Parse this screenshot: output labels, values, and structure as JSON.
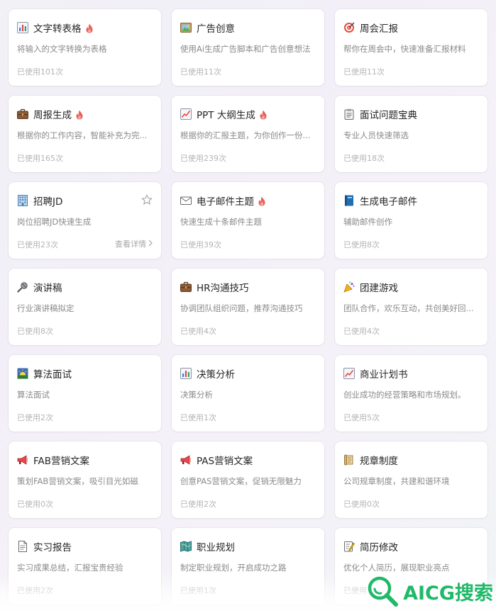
{
  "cards": [
    {
      "title": "文字转表格",
      "desc": "将输入的文字转换为表格",
      "usage": "已使用101次",
      "icon": "bar-chart-icon",
      "hot": true
    },
    {
      "title": "广告创意",
      "desc": "使用Ai生成广告脚本和广告创意想法",
      "usage": "已使用11次",
      "icon": "picture-icon",
      "hot": false
    },
    {
      "title": "周会汇报",
      "desc": "帮你在周会中，快速准备汇报材料",
      "usage": "已使用11次",
      "icon": "target-icon",
      "hot": false
    },
    {
      "title": "周报生成",
      "desc": "根据你的工作内容，智能补充为完...",
      "usage": "已使用165次",
      "icon": "briefcase-icon",
      "hot": true
    },
    {
      "title": "PPT 大纲生成",
      "desc": "根据你的汇报主题，为你创作一份...",
      "usage": "已使用239次",
      "icon": "trend-chart-icon",
      "hot": true
    },
    {
      "title": "面试问题宝典",
      "desc": "专业人员快速筛选",
      "usage": "已使用18次",
      "icon": "clipboard-icon",
      "hot": false
    },
    {
      "title": "招聘JD",
      "desc": "岗位招聘JD快速生成",
      "usage": "已使用23次",
      "icon": "office-building-icon",
      "hot": false
    },
    {
      "title": "电子邮件主题",
      "desc": "快速生成十条邮件主题",
      "usage": "已使用39次",
      "icon": "envelope-icon",
      "hot": true
    },
    {
      "title": "生成电子邮件",
      "desc": "辅助邮件创作",
      "usage": "已使用8次",
      "icon": "book-icon",
      "hot": false
    },
    {
      "title": "演讲稿",
      "desc": "行业演讲稿拟定",
      "usage": "已使用8次",
      "icon": "microphone-icon",
      "hot": false
    },
    {
      "title": "HR沟通技巧",
      "desc": "协调团队组织问题，推荐沟通技巧",
      "usage": "已使用4次",
      "icon": "briefcase-icon",
      "hot": false
    },
    {
      "title": "团建游戏",
      "desc": "团队合作，欢乐互动，共创美好回...",
      "usage": "已使用4次",
      "icon": "party-popper-icon",
      "hot": false
    },
    {
      "title": "算法面试",
      "desc": "算法面试",
      "usage": "已使用2次",
      "icon": "sunrise-icon",
      "hot": false
    },
    {
      "title": "决策分析",
      "desc": "决策分析",
      "usage": "已使用1次",
      "icon": "bar-chart-icon",
      "hot": false
    },
    {
      "title": "商业计划书",
      "desc": "创业成功的经营策略和市场规划。",
      "usage": "已使用5次",
      "icon": "trend-chart-icon",
      "hot": false
    },
    {
      "title": "FAB营销文案",
      "desc": "策划FAB营销文案，吸引目光如磁",
      "usage": "已使用0次",
      "icon": "megaphone-icon",
      "hot": false
    },
    {
      "title": "PAS营销文案",
      "desc": "创意PAS营销文案，促销无限魅力",
      "usage": "已使用2次",
      "icon": "megaphone-icon",
      "hot": false
    },
    {
      "title": "规章制度",
      "desc": "公司规章制度，共建和谐环境",
      "usage": "已使用0次",
      "icon": "scroll-icon",
      "hot": false
    },
    {
      "title": "实习报告",
      "desc": "实习成果总结，汇报宝贵经验",
      "usage": "已使用2次",
      "icon": "document-icon",
      "hot": false
    },
    {
      "title": "职业规划",
      "desc": "制定职业规划，开启成功之路",
      "usage": "已使用1次",
      "icon": "map-icon",
      "hot": false
    },
    {
      "title": "简历修改",
      "desc": "优化个人简历，展现职业亮点",
      "usage": "已使用",
      "icon": "memo-icon",
      "hot": false
    }
  ],
  "detail_link": "查看详情",
  "watermark": "AICG搜索",
  "colors": {
    "hot": "#e8615a",
    "watermark": "#1fb96a"
  }
}
